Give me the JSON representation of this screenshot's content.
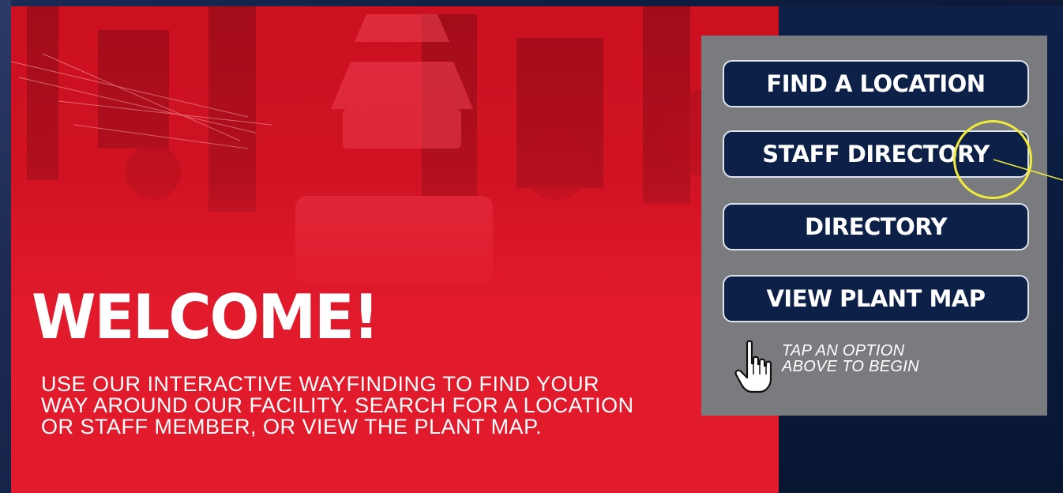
{
  "welcome": {
    "title": "WELCOME!",
    "body": "USE OUR INTERACTIVE WAYFINDING TO FIND YOUR WAY AROUND OUR FACILITY. SEARCH FOR A LOCATION OR STAFF MEMBER, OR VIEW THE PLANT MAP."
  },
  "menu": {
    "buttons": [
      {
        "label": "FIND A LOCATION"
      },
      {
        "label": "STAFF DIRECTORY"
      },
      {
        "label": "DIRECTORY"
      },
      {
        "label": "VIEW PLANT MAP"
      }
    ],
    "hint_line1": "TAP AN OPTION",
    "hint_line2": "ABOVE TO BEGIN",
    "hint_icon": "pointing-hand-icon"
  },
  "highlight": {
    "target": "STAFF DIRECTORY",
    "color": "#f2ea3a"
  },
  "colors": {
    "hero_red": "#e11a2c",
    "navy": "#0d2048",
    "panel_gray": "#7a7b7e"
  }
}
